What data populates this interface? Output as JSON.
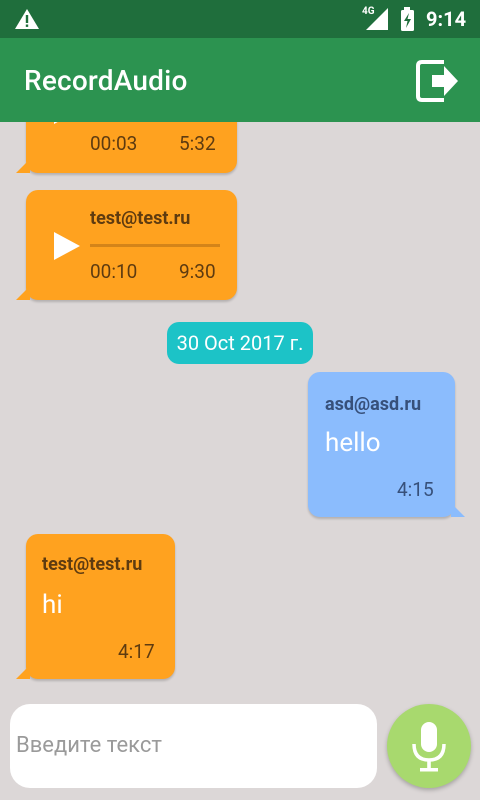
{
  "status_bar": {
    "network_type": "4G",
    "time": "9:14",
    "icons": [
      "warning-icon",
      "signal-icon",
      "battery-icon"
    ]
  },
  "app_bar": {
    "title": "RecordAudio",
    "action_icon": "exit-icon"
  },
  "messages": [
    {
      "type": "audio",
      "side": "left",
      "sender": "",
      "position": "00:03",
      "duration": "5:32"
    },
    {
      "type": "audio",
      "side": "left",
      "sender": "test@test.ru",
      "position": "00:10",
      "duration": "9:30"
    },
    {
      "type": "date",
      "text": "30 Oct 2017 г."
    },
    {
      "type": "text",
      "side": "right",
      "sender": "asd@asd.ru",
      "text": "hello",
      "time": "4:15"
    },
    {
      "type": "text",
      "side": "left",
      "sender": "test@test.ru",
      "text": "hi",
      "time": "4:17"
    }
  ],
  "input": {
    "placeholder": "Введите текст",
    "mic_icon": "microphone-icon"
  },
  "colors": {
    "status_bar": "#1f6e3c",
    "app_bar": "#2c9350",
    "chat_background": "#dcd7d7",
    "incoming_bubble": "#ffa21f",
    "outgoing_bubble": "#8bbcfd",
    "date_chip": "#1cc3c7",
    "mic_button": "#a8d96e"
  }
}
